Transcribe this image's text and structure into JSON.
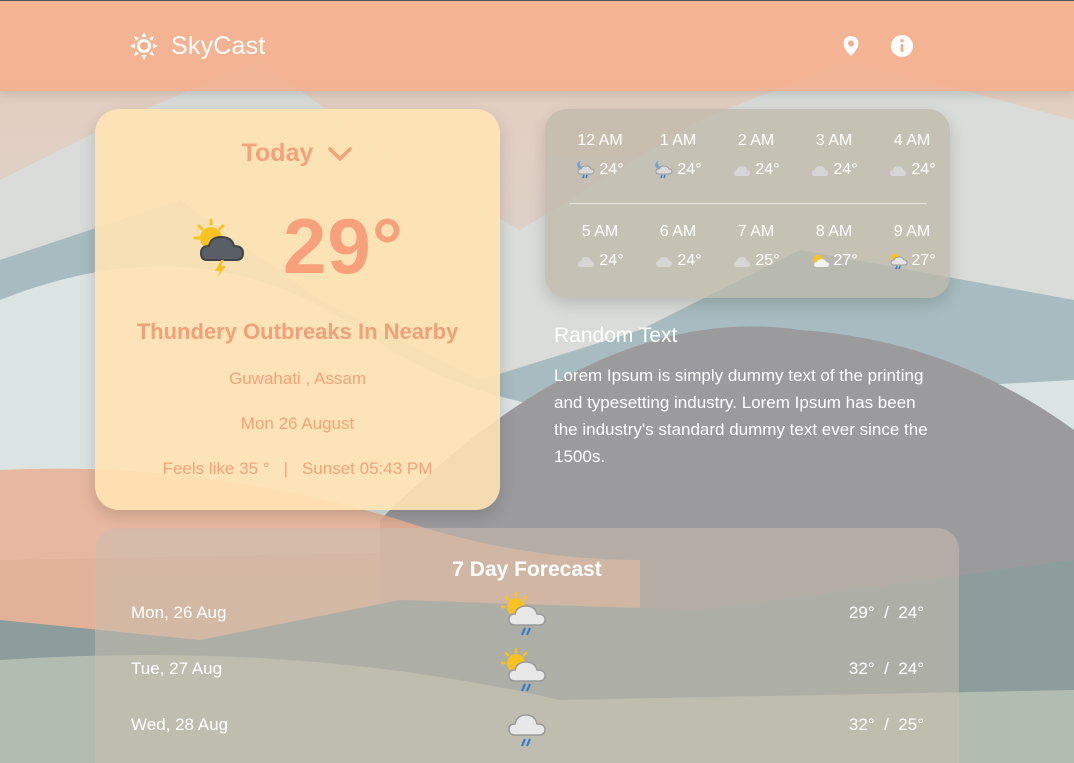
{
  "header": {
    "brand": "SkyCast",
    "logo_icon": "sun-icon",
    "location_icon": "location-pin-icon",
    "info_icon": "info-icon"
  },
  "today": {
    "selector_label": "Today",
    "temperature": "29°",
    "condition": "Thundery Outbreaks In Nearby",
    "location": "Guwahati , Assam",
    "date": "Mon 26 August",
    "feels_like": "Feels like 35 °",
    "separator": "|",
    "sunset": "Sunset 05:43 PM",
    "icon": "thunder-sun-cloud-icon"
  },
  "hourly": [
    {
      "time": "12 AM",
      "temp": "24°",
      "icon": "night-rain-icon"
    },
    {
      "time": "1 AM",
      "temp": "24°",
      "icon": "night-rain-icon"
    },
    {
      "time": "2 AM",
      "temp": "24°",
      "icon": "cloud-icon"
    },
    {
      "time": "3 AM",
      "temp": "24°",
      "icon": "cloud-icon"
    },
    {
      "time": "4 AM",
      "temp": "24°",
      "icon": "cloud-icon"
    },
    {
      "time": "5 AM",
      "temp": "24°",
      "icon": "cloud-icon"
    },
    {
      "time": "6 AM",
      "temp": "24°",
      "icon": "cloud-icon"
    },
    {
      "time": "7 AM",
      "temp": "25°",
      "icon": "cloud-icon"
    },
    {
      "time": "8 AM",
      "temp": "27°",
      "icon": "partly-cloudy-icon"
    },
    {
      "time": "9 AM",
      "temp": "27°",
      "icon": "sun-rain-icon"
    }
  ],
  "random": {
    "title": "Random Text",
    "body": "Lorem Ipsum is simply dummy text of the printing and typesetting industry. Lorem Ipsum has been the industry's standard dummy text ever since the 1500s."
  },
  "week": {
    "title": "7 Day Forecast",
    "days": [
      {
        "date": "Mon, 26 Aug",
        "high": "29°",
        "sep": "/",
        "low": "24°",
        "icon": "sun-rain-icon"
      },
      {
        "date": "Tue, 27 Aug",
        "high": "32°",
        "sep": "/",
        "low": "24°",
        "icon": "sun-rain-icon"
      },
      {
        "date": "Wed, 28 Aug",
        "high": "32°",
        "sep": "/",
        "low": "25°",
        "icon": "rain-cloud-icon"
      }
    ]
  },
  "colors": {
    "header": "#f7ac88",
    "today_card": "#ffe3b2",
    "accent_text": "#f5a27a"
  }
}
